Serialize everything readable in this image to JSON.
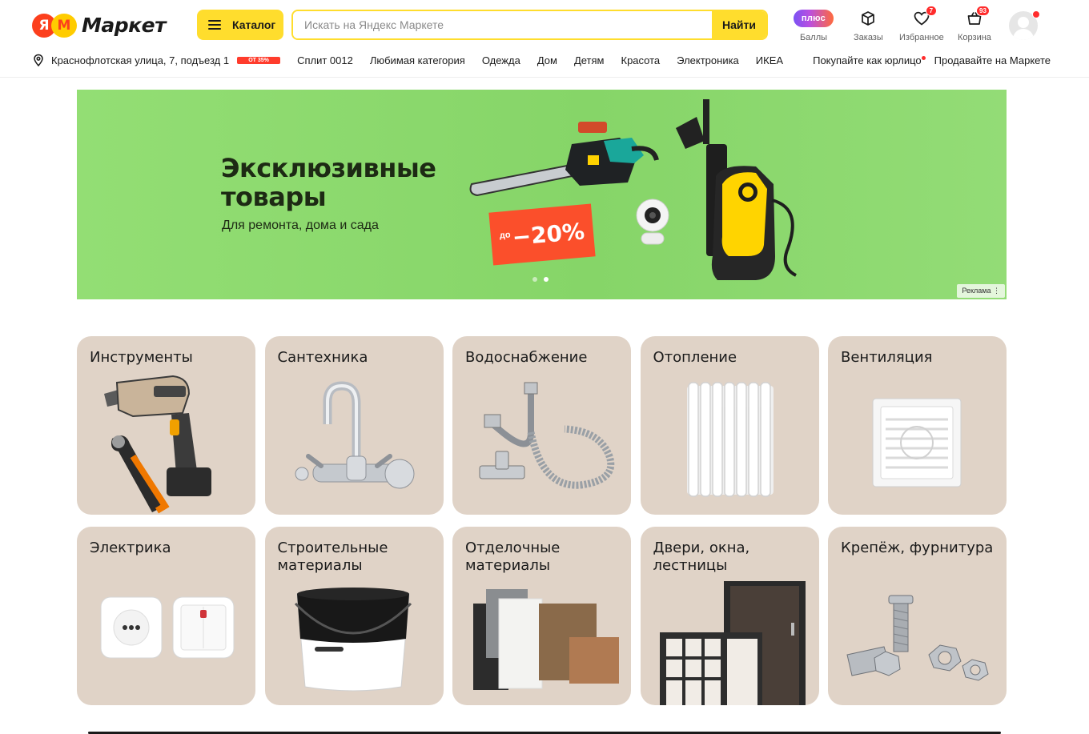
{
  "header": {
    "logo_mark": "ЯМ",
    "logo_text": "Маркет",
    "catalog_label": "Каталог",
    "search_placeholder": "Искать на Яндекс Маркете",
    "search_button": "Найти",
    "plus_label": "плюс",
    "icons": [
      {
        "name": "plus-icon",
        "caption": "Баллы"
      },
      {
        "name": "orders-icon",
        "caption": "Заказы"
      },
      {
        "name": "favorites-icon",
        "caption": "Избранное",
        "badge": "7"
      },
      {
        "name": "cart-icon",
        "caption": "Корзина",
        "badge": "93"
      }
    ]
  },
  "subnav": {
    "address": "Краснофлотская улица, 7, подъезд 1",
    "promo_pill": "ОТ 35%",
    "links": [
      "Сплит 0012",
      "Любимая категория",
      "Одежда",
      "Дом",
      "Детям",
      "Красота",
      "Электроника",
      "ИКЕА"
    ],
    "right_links": [
      "Покупайте как юрлицо",
      "Продавайте на Маркете"
    ]
  },
  "banner": {
    "title": "Эксклюзивные товары",
    "subtitle": "Для ремонта, дома и сада",
    "promo_prefix": "до",
    "promo_value": "−20%",
    "ad_label": "Реклама ⋮",
    "slides": 2,
    "active_slide": 2
  },
  "categories": [
    {
      "title": "Инструменты",
      "icon": "drill-wrench"
    },
    {
      "title": "Сантехника",
      "icon": "faucet"
    },
    {
      "title": "Водоснабжение",
      "icon": "hose-fittings"
    },
    {
      "title": "Отопление",
      "icon": "radiator"
    },
    {
      "title": "Вентиляция",
      "icon": "vent-fan"
    },
    {
      "title": "Электрика",
      "icon": "socket-switch"
    },
    {
      "title": "Строительные материалы",
      "icon": "paint-bucket"
    },
    {
      "title": "Отделочные материалы",
      "icon": "tile-samples"
    },
    {
      "title": "Двери, окна, лестницы",
      "icon": "door-window"
    },
    {
      "title": "Крепёж, фурнитура",
      "icon": "bolts-nuts"
    }
  ],
  "colors": {
    "brand_yellow": "#ffdd2d",
    "brand_red": "#fc3f1d",
    "banner_green": "#8bd76c",
    "card_beige": "#e0d3c7",
    "badge_red": "#ff2c2c"
  }
}
